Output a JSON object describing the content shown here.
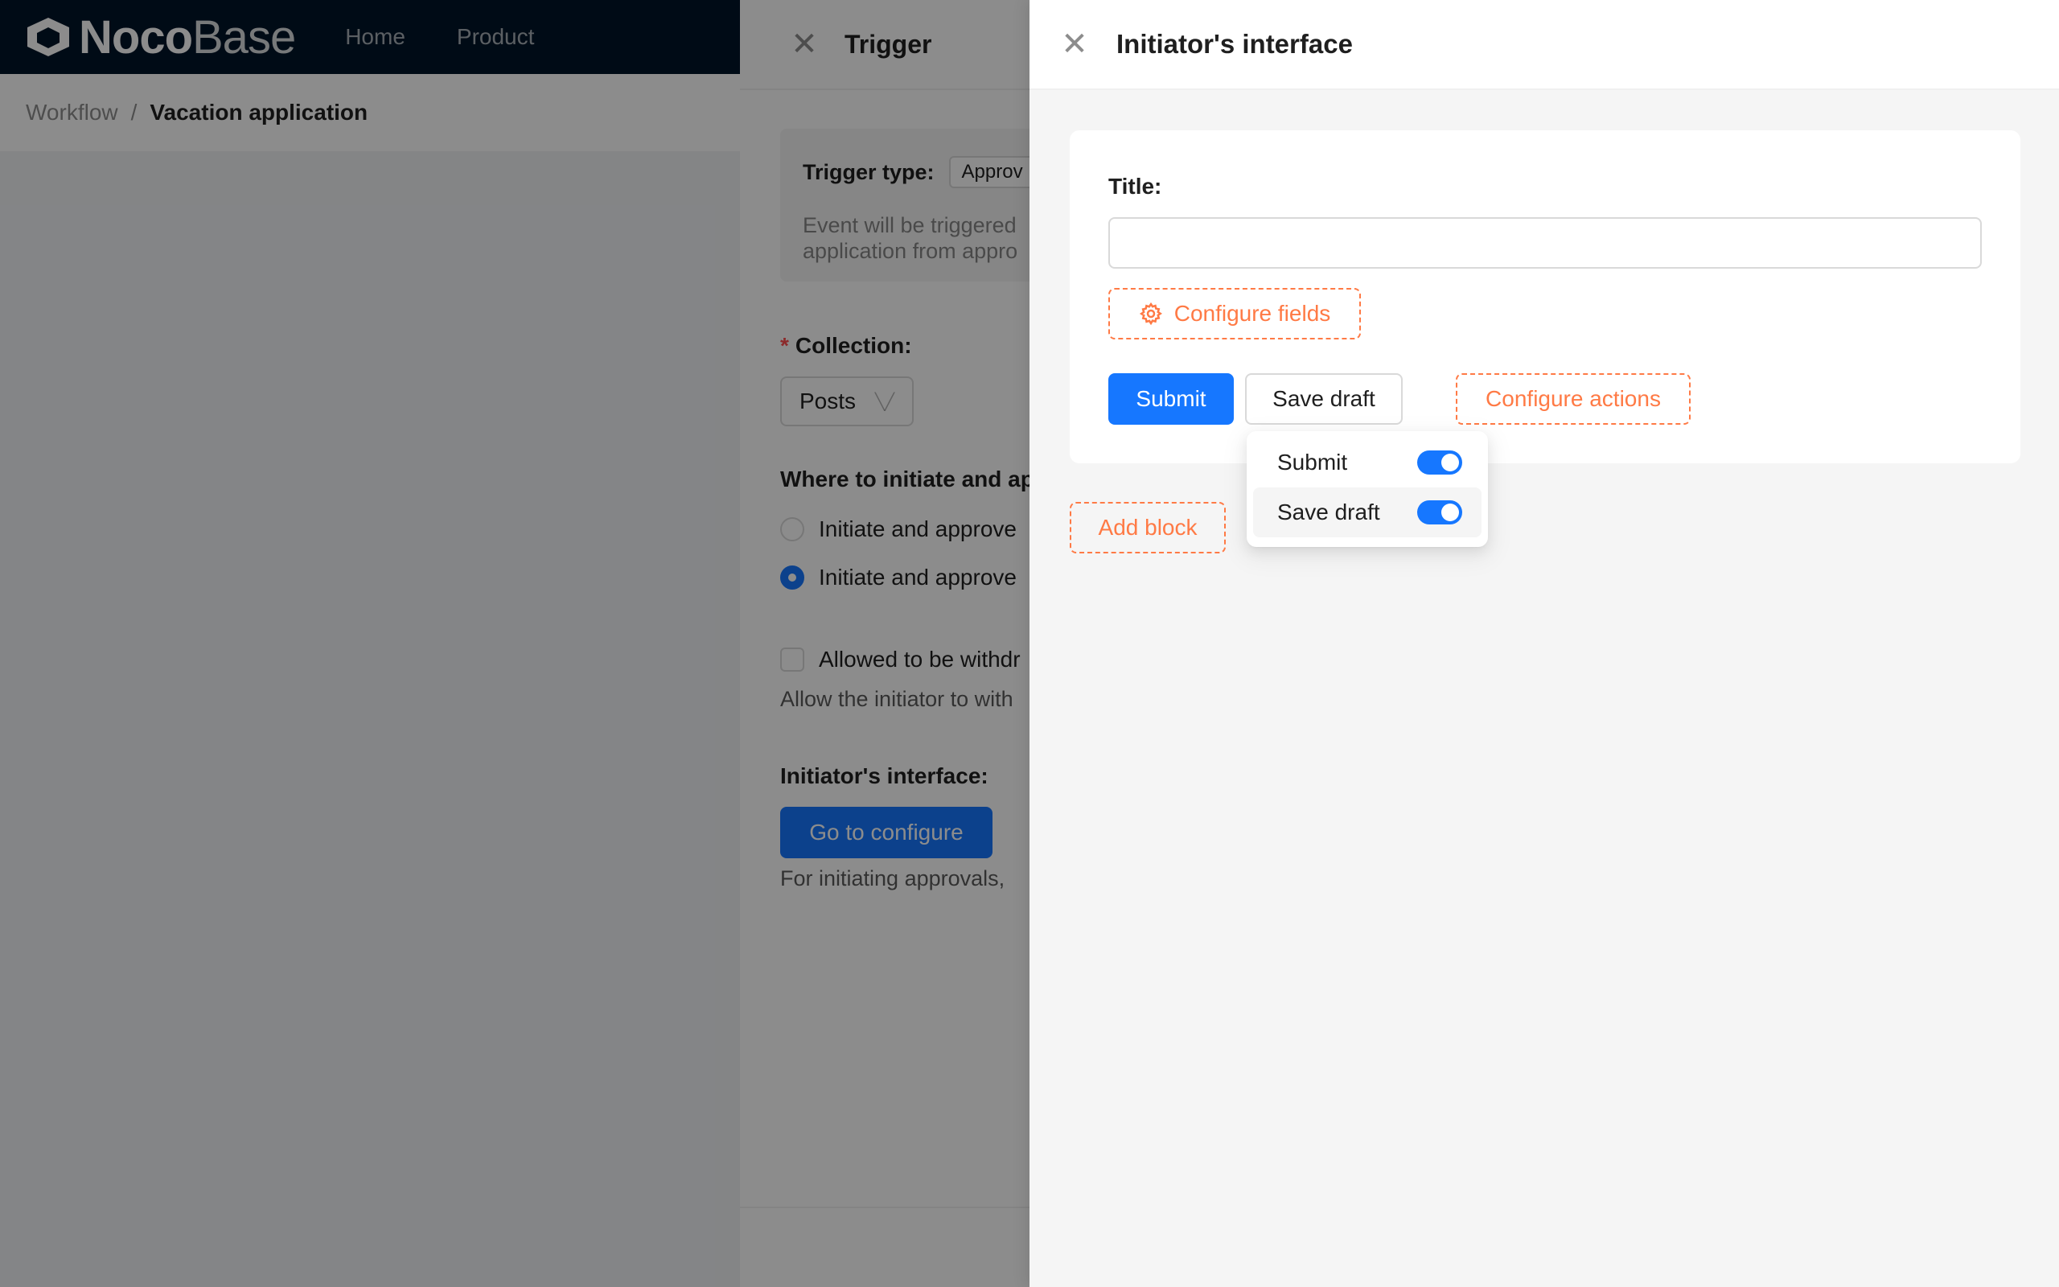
{
  "app": {
    "logo_bold": "Noco",
    "logo_light": "Base",
    "menu": [
      "Home",
      "Product"
    ]
  },
  "breadcrumb": {
    "parent": "Workflow",
    "separator": "/",
    "current": "Vacation application"
  },
  "trigger_drawer": {
    "title": "Trigger",
    "trigger_type_label": "Trigger type:",
    "trigger_type_value": "Approv",
    "trigger_desc_line1": "Event will be triggered",
    "trigger_desc_line2": "application from appro",
    "collection_label": "Collection:",
    "collection_value": "Posts",
    "where_label": "Where to initiate and ap",
    "radio_options": [
      "Initiate and approve",
      "Initiate and approve"
    ],
    "withdraw_label": "Allowed to be withdr",
    "withdraw_desc": "Allow the initiator to with",
    "initiator_label": "Initiator's interface:",
    "configure_button": "Go to configure",
    "initiator_desc": "For initiating approvals,"
  },
  "initiator_drawer": {
    "title": "Initiator's interface",
    "field_label": "Title:",
    "field_value": "",
    "configure_fields": "Configure fields",
    "submit": "Submit",
    "save_draft": "Save draft",
    "configure_actions": "Configure actions",
    "add_block": "Add block"
  },
  "actions_dropdown": {
    "items": [
      {
        "label": "Submit",
        "enabled": true
      },
      {
        "label": "Save draft",
        "enabled": true
      }
    ]
  },
  "colors": {
    "primary": "#1677ff",
    "dashed_accent": "#ff7a45",
    "header_dark": "#001529"
  }
}
